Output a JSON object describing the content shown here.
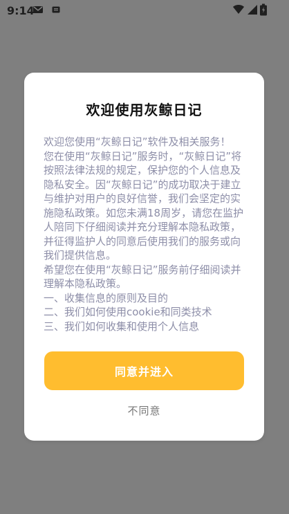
{
  "status_bar": {
    "time": "9:14",
    "icons_left": [
      "mail-icon",
      "message-icon"
    ],
    "icons_right": [
      "wifi-icon",
      "cellular-icon",
      "battery-icon"
    ]
  },
  "dialog": {
    "title": "欢迎使用灰鲸日记",
    "content": [
      " 欢迎您使用“灰鲸日记”软件及相关服务！",
      "您在使用“灰鲸日记”服务时，“灰鲸日记”将按照法律法规的规定，保护您的个人信息及隐私安全。因“灰鲸日记”的成功取决于建立与维护对用户的良好信誉，我们会坚定的实施隐私政策。如您未满18周岁，请您在监护人陪同下仔细阅读并充分理解本隐私政策，并征得监护人的同意后使用我们的服务或向我们提供信息。",
      "希望您在使用“灰鲸日记”服务前仔细阅读并理解本隐私政策。",
      "一、收集信息的原则及目的",
      "二、我们如何使用cookie和同类技术",
      "三、我们如何收集和使用个人信息"
    ],
    "agree_label": "同意并进入",
    "disagree_label": "不同意"
  },
  "colors": {
    "overlay": "#7f7f7f",
    "accent": "#ffbd2f",
    "content_text": "#8d8ea8"
  }
}
